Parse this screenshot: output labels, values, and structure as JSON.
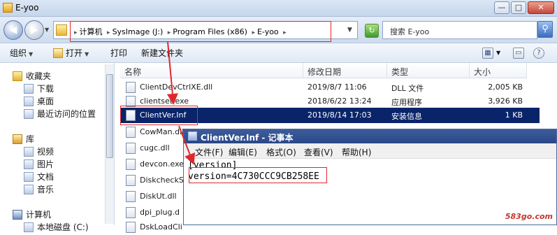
{
  "window": {
    "title": "E-yoo"
  },
  "window_buttons": {
    "minimize": "—",
    "maximize": "□",
    "close": "✕"
  },
  "address": {
    "crumbs": [
      "计算机",
      "SysImage (J:)",
      "Program Files (x86)",
      "E-yoo"
    ],
    "separator": "▸"
  },
  "search": {
    "placeholder": "搜索 E-yoo"
  },
  "toolbar": {
    "organize": "组织",
    "open": "打开",
    "print": "打印",
    "new_folder": "新建文件夹"
  },
  "nav": {
    "favorites": {
      "label": "收藏夹",
      "items": [
        "下载",
        "桌面",
        "最近访问的位置"
      ]
    },
    "libraries": {
      "label": "库",
      "items": [
        "视频",
        "图片",
        "文档",
        "音乐"
      ]
    },
    "computer": {
      "label": "计算机",
      "items": [
        "本地磁盘 (C:)"
      ]
    }
  },
  "columns": {
    "name": "名称",
    "date": "修改日期",
    "type": "类型",
    "size": "大小"
  },
  "files": [
    {
      "name": "ClientDevCtrlXE.dll",
      "date": "2019/8/7 11:06",
      "type": "DLL 文件",
      "size": "2,005 KB"
    },
    {
      "name": "clientset.exe",
      "date": "2018/6/22 13:24",
      "type": "应用程序",
      "size": "3,926 KB"
    },
    {
      "name": "ClientVer.Inf",
      "date": "2019/8/14 17:03",
      "type": "安装信息",
      "size": "1 KB",
      "selected": true
    },
    {
      "name": "CowMan.dll",
      "date": "",
      "type": "",
      "size": ""
    },
    {
      "name": "cugc.dll",
      "date": "",
      "type": "",
      "size": ""
    },
    {
      "name": "devcon.exe",
      "date": "",
      "type": "",
      "size": ""
    },
    {
      "name": "DiskcheckS",
      "date": "",
      "type": "",
      "size": ""
    },
    {
      "name": "DiskUt.dll",
      "date": "",
      "type": "",
      "size": ""
    },
    {
      "name": "dpi_plug.d",
      "date": "",
      "type": "",
      "size": ""
    },
    {
      "name": "DskLoadCli",
      "date": "",
      "type": "",
      "size": ""
    }
  ],
  "notepad": {
    "title": "ClientVer.Inf - 记事本",
    "menu": [
      "文件(F)",
      "编辑(E)",
      "格式(O)",
      "查看(V)",
      "帮助(H)"
    ],
    "lines": [
      "[version]",
      "version=4C730CCC9CB258EE"
    ]
  },
  "watermark": "583go.com",
  "colors": {
    "highlight": "#0a246a",
    "annotation": "#e0282c"
  }
}
